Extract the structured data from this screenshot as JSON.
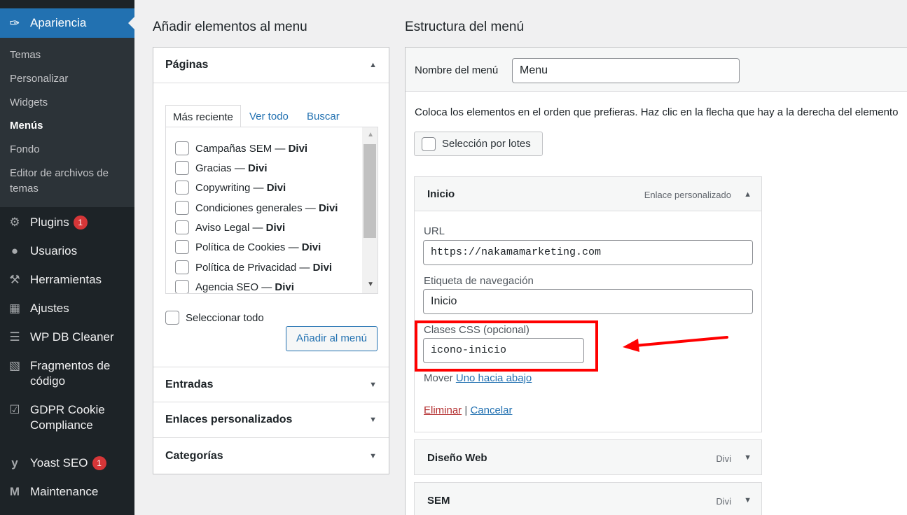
{
  "sidebar": {
    "current": {
      "label": "Apariencia",
      "icon": "paintbrush-icon"
    },
    "submenu": [
      "Temas",
      "Personalizar",
      "Widgets",
      "Menús",
      "Fondo",
      "Editor de archivos de",
      "temas"
    ],
    "items": [
      {
        "label": "Plugins",
        "icon": "plugin-icon",
        "badge": "1"
      },
      {
        "label": "Usuarios",
        "icon": "user-icon"
      },
      {
        "label": "Herramientas",
        "icon": "wrench-icon"
      },
      {
        "label": "Ajustes",
        "icon": "settings-sliders-icon"
      },
      {
        "label": "WP DB Cleaner",
        "icon": "database-icon"
      },
      {
        "label": "Fragmentos de",
        "label2": "código",
        "icon": "code-snippet-icon"
      },
      {
        "label": "GDPR Cookie",
        "label2": "Compliance",
        "icon": "checkmark-icon"
      },
      {
        "label": "Yoast SEO",
        "icon": "yoast-icon",
        "badge": "1"
      },
      {
        "label": "Maintenance",
        "icon": "maintenance-m-icon"
      }
    ]
  },
  "left": {
    "heading": "Añadir elementos al menu",
    "pages": {
      "title": "Páginas",
      "tabs": [
        "Más reciente",
        "Ver todo",
        "Buscar"
      ],
      "list": [
        {
          "name": "Campañas SEM",
          "sep": " — ",
          "tag": "Divi"
        },
        {
          "name": "Gracias",
          "sep": " — ",
          "tag": "Divi"
        },
        {
          "name": "Copywriting",
          "sep": " — ",
          "tag": "Divi"
        },
        {
          "name": "Condiciones generales",
          "sep": " — ",
          "tag": "Divi"
        },
        {
          "name": "Aviso Legal",
          "sep": " — ",
          "tag": "Divi"
        },
        {
          "name": "Política de Cookies",
          "sep": " — ",
          "tag": "Divi"
        },
        {
          "name": "Política de Privacidad",
          "sep": " — ",
          "tag": "Divi"
        },
        {
          "name": "Agencia SEO",
          "sep": " — ",
          "tag": "Divi"
        }
      ],
      "select_all": "Seleccionar todo",
      "add_button": "Añadir al menú"
    },
    "sections": [
      "Entradas",
      "Enlaces personalizados",
      "Categorías"
    ]
  },
  "right": {
    "heading": "Estructura del menú",
    "name_label": "Nombre del menú",
    "name_value": "Menu",
    "description": "Coloca los elementos en el orden que prefieras. Haz clic en la flecha que hay a la derecha del elemento",
    "bulk_label": "Selección por lotes",
    "item": {
      "title": "Inicio",
      "type": "Enlace personalizado",
      "url_label": "URL",
      "url_value": "https://nakamamarketing.com",
      "nav_label": "Etiqueta de navegación",
      "nav_value": "Inicio",
      "css_label": "Clases CSS (opcional)",
      "css_value": "icono-inicio",
      "move_label": "Mover",
      "move_link": "Uno hacia abajo",
      "delete_link": "Eliminar",
      "separator": "|",
      "cancel_link": "Cancelar"
    },
    "items_collapsed": [
      {
        "title": "Diseño Web",
        "type": "Divi"
      },
      {
        "title": "SEM",
        "type": "Divi"
      }
    ]
  },
  "colors": {
    "wp_blue": "#2271b1",
    "sidebar": "#1d2327",
    "highlight_red": "#ff0000"
  }
}
